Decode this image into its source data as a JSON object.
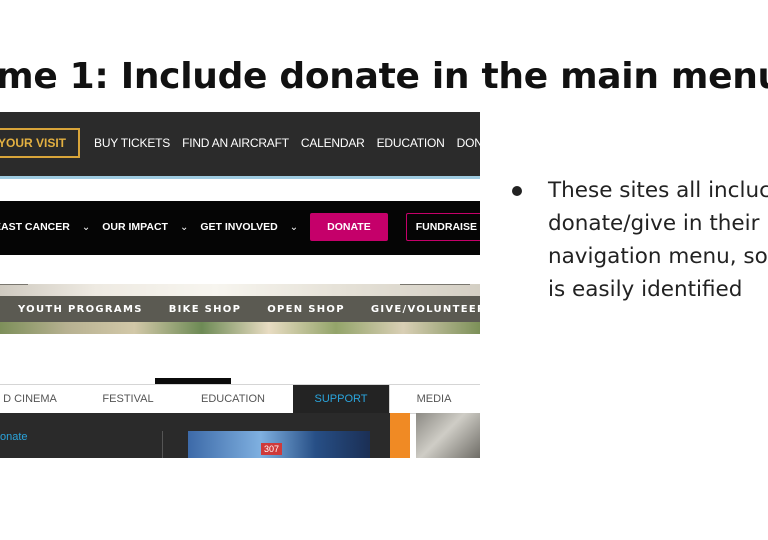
{
  "slide": {
    "title": "eme 1: Include donate in the main menu"
  },
  "examples": [
    {
      "visit_button": "YOUR VISIT",
      "items": [
        "BUY TICKETS",
        "FIND AN AIRCRAFT",
        "CALENDAR",
        "EDUCATION",
        "DONATE"
      ]
    },
    {
      "items": [
        "EAST CANCER",
        "OUR IMPACT",
        "GET INVOLVED"
      ],
      "donate_button": "DONATE",
      "fundraise_button": "FUNDRAISE",
      "accent_color": "#c5006a"
    },
    {
      "items": [
        "YOUTH PROGRAMS",
        "BIKE SHOP",
        "OPEN SHOP",
        "GIVE/VOLUNTEER"
      ]
    },
    {
      "items": [
        "D CINEMA",
        "FESTIVAL",
        "EDUCATION",
        "SUPPORT",
        "MEDIA"
      ],
      "active_item": "SUPPORT",
      "submenu_link": "onate",
      "image_badge": "307",
      "accent_color": "#2aa4dc"
    }
  ],
  "bullets": [
    {
      "lines": [
        "These sites all incluc",
        "donate/give in their",
        "navigation menu, so",
        "is easily identified"
      ]
    }
  ]
}
